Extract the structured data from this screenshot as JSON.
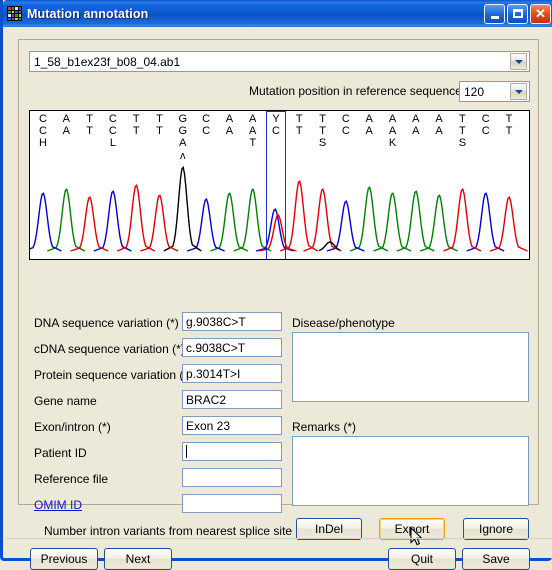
{
  "window": {
    "title": "Mutation annotation",
    "icon": "grid-icon",
    "controls": {
      "minimize": "minimize",
      "maximize": "maximize",
      "close": "close"
    },
    "title_colors": {
      "active_start": "#2a78e8",
      "active_end": "#0a50c8",
      "close": "#e24a18"
    }
  },
  "top": {
    "file_selected": "1_58_b1ex23f_b08_04.ab1",
    "position_label": "Mutation position in reference sequence",
    "position_value": "120"
  },
  "chromatogram": {
    "variant_index": 10,
    "colors": {
      "A": "#008000",
      "C": "#0000d0",
      "G": "#000000",
      "T": "#e00000",
      "variant_box": "#2030c8"
    },
    "columns": [
      {
        "top": "C",
        "mid": "C",
        "bot": "H"
      },
      {
        "top": "A",
        "mid": "A",
        "bot": ""
      },
      {
        "top": "T",
        "mid": "T",
        "bot": ""
      },
      {
        "top": "C",
        "mid": "C",
        "bot": "L"
      },
      {
        "top": "T",
        "mid": "T",
        "bot": ""
      },
      {
        "top": "T",
        "mid": "T",
        "bot": ""
      },
      {
        "top": "G",
        "mid": "G",
        "bot": "A"
      },
      {
        "top": "C",
        "mid": "C",
        "bot": ""
      },
      {
        "top": "A",
        "mid": "A",
        "bot": ""
      },
      {
        "top": "A",
        "mid": "A",
        "bot": "T"
      },
      {
        "top": "Y",
        "mid": "C",
        "bot": ""
      },
      {
        "top": "T",
        "mid": "T",
        "bot": ""
      },
      {
        "top": "T",
        "mid": "T",
        "bot": "S"
      },
      {
        "top": "C",
        "mid": "C",
        "bot": ""
      },
      {
        "top": "A",
        "mid": "A",
        "bot": ""
      },
      {
        "top": "A",
        "mid": "A",
        "bot": "K"
      },
      {
        "top": "A",
        "mid": "A",
        "bot": ""
      },
      {
        "top": "A",
        "mid": "A",
        "bot": ""
      },
      {
        "top": "T",
        "mid": "T",
        "bot": "S"
      },
      {
        "top": "C",
        "mid": "C",
        "bot": ""
      },
      {
        "top": "T",
        "mid": "T",
        "bot": ""
      }
    ],
    "caret_marker": "ʌ"
  },
  "form": {
    "dna_label": "DNA sequence variation (*)",
    "dna_value": "g.9038C>T",
    "cdna_label": "cDNA sequence variation (*)",
    "cdna_value": "c.9038C>T",
    "protein_label": "Protein sequence variation (*)",
    "protein_value": "p.3014T>I",
    "gene_label": "Gene name",
    "gene_value": "BRAC2",
    "exon_label": "Exon/intron (*)",
    "exon_value": "Exon 23",
    "patient_label": "Patient ID",
    "patient_value": "",
    "reffile_label": "Reference file",
    "reffile_value": "",
    "omim_label": "OMIM ID",
    "omim_value": "",
    "checkbox_label": "Number intron variants from nearest splice site",
    "checkbox_checked": true,
    "disease_label": "Disease/phenotype",
    "disease_value": "",
    "remarks_label": "Remarks (*)",
    "remarks_value": ""
  },
  "buttons": {
    "indel": "InDel",
    "export": "Export",
    "ignore": "Ignore",
    "previous": "Previous",
    "next": "Next",
    "quit": "Quit",
    "save": "Save",
    "focused": "Export"
  }
}
